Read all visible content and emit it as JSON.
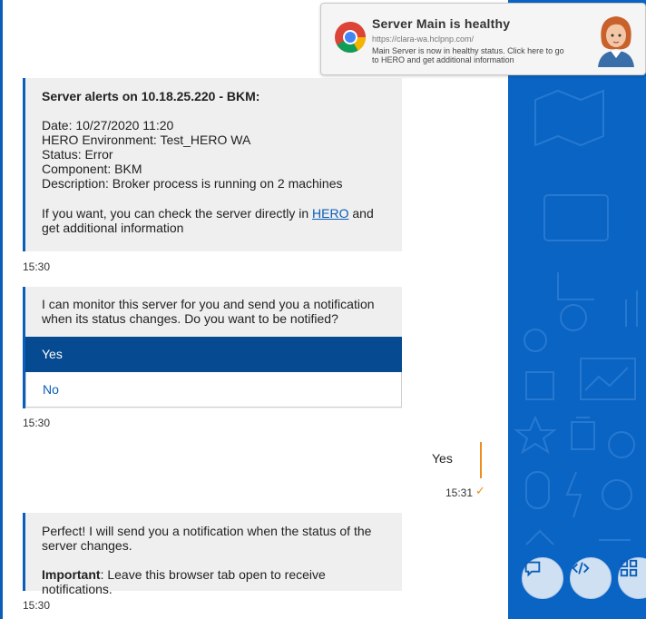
{
  "notification": {
    "title": "Server Main is healthy",
    "url": "https://clara-wa.hclpnp.com/",
    "body": "Main Server is now in healthy status. Click here to go to HERO and get additional information",
    "app_icon": "chrome-icon",
    "avatar_icon": "assistant-avatar-icon"
  },
  "alert": {
    "title": "Server alerts on 10.18.25.220 - BKM:",
    "date": "Date: 10/27/2020 11:20",
    "environment": "HERO Environment: Test_HERO WA",
    "status": "Status: Error",
    "component": "Component: BKM",
    "description": "Description: Broker process is running on 2 machines",
    "foot_pre": "If you want, you can check the server directly in",
    "foot_link": "HERO",
    "foot_post": "and get additional information",
    "time": "15:30"
  },
  "prompt": {
    "question": "I can monitor this server for you and send you a notification when its status changes. Do you want to be notified?",
    "yes_label": "Yes",
    "no_label": "No",
    "time": "15:30"
  },
  "user_reply": {
    "text": "Yes",
    "time": "15:31",
    "status_icon": "check-icon"
  },
  "confirmation": {
    "text": "Perfect! I will send you a notification when the status of the server changes.",
    "important_label": "Important",
    "important_text": ": Leave this browser tab open to receive notifications.",
    "time": "15:30"
  },
  "colors": {
    "accent": "#0a5db8",
    "selected": "#064a91",
    "panel": "#0a64c4",
    "user_accent": "#f08c1e"
  },
  "fabs": [
    {
      "icon": "chat-icon"
    },
    {
      "icon": "code-icon"
    },
    {
      "icon": "grid-icon"
    }
  ]
}
